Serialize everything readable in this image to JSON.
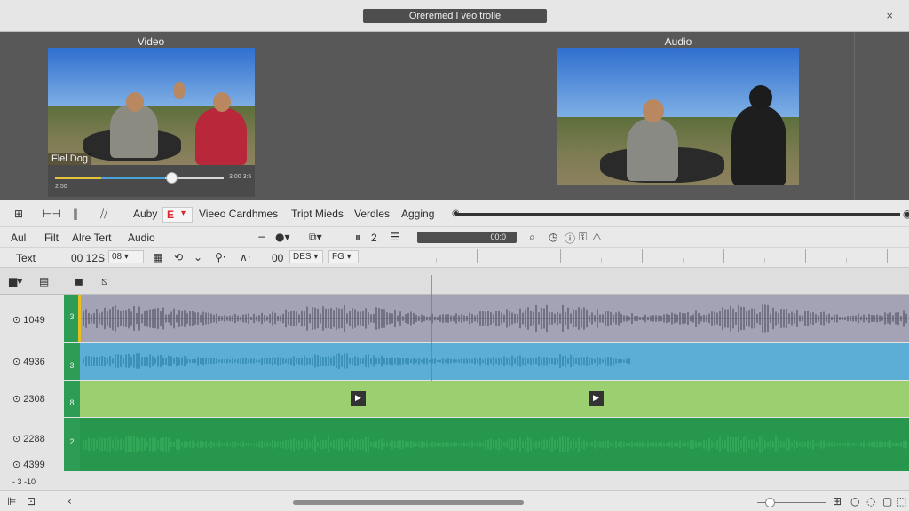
{
  "window": {
    "title": "Oreremed I veo trolle",
    "close": "×"
  },
  "preview": {
    "video_label": "Video",
    "audio_label": "Audio",
    "caption": "Flel Dog",
    "time_left": "2:50",
    "time_right": "3:00 3:5"
  },
  "toolbar1": {
    "icons": [
      "grid-icon",
      "width-icon",
      "split-icon",
      "mute-icon"
    ],
    "items": [
      "Auby",
      "Vieeo Cardhmes",
      "Tript Mieds",
      "Verdles",
      "Agging"
    ],
    "red_flag": "E",
    "dropdown_caret": "▾"
  },
  "toolbar2": {
    "items": [
      "Aul",
      "Filt",
      "Alre Tert",
      "Audio"
    ],
    "page_value": "2",
    "counter": "00:0",
    "tools": [
      "search-icon",
      "clock-icon",
      "lock-icon",
      "warning-icon"
    ]
  },
  "toolbar3": {
    "label": "Text",
    "timecode": "00 12S",
    "fps": "08",
    "zoom": "00",
    "des": "DES",
    "fg": "FG"
  },
  "tracks": [
    {
      "label": "1049",
      "tab": "3",
      "color": "#a4a3b5"
    },
    {
      "label": "4936",
      "tab": "3",
      "color": "#5caed6"
    },
    {
      "label": "2308",
      "tab": "8",
      "color": "#9ccf70"
    },
    {
      "label": "2288",
      "tab": "2",
      "color": "#26974c"
    }
  ],
  "extra_label": "4399",
  "footer": {
    "scale": "- 3 -10"
  },
  "colors": {
    "accent_green": "#26974c",
    "accent_blue": "#5caed6",
    "accent_lilac": "#a4a3b5",
    "accent_lime": "#9ccf70"
  }
}
